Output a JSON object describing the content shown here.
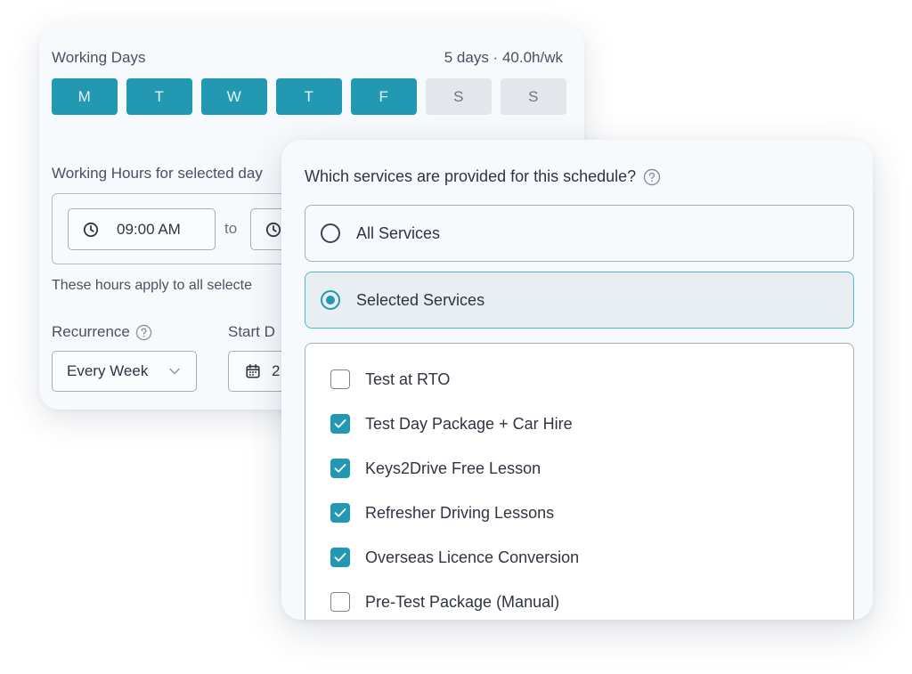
{
  "working_days": {
    "title": "Working Days",
    "summary": "5 days · 40.0h/wk",
    "days": [
      {
        "label": "M",
        "active": true
      },
      {
        "label": "T",
        "active": true
      },
      {
        "label": "W",
        "active": true
      },
      {
        "label": "T",
        "active": true
      },
      {
        "label": "F",
        "active": true
      },
      {
        "label": "S",
        "active": false
      },
      {
        "label": "S",
        "active": false
      }
    ]
  },
  "working_hours": {
    "label": "Working Hours for selected day",
    "start_time": "09:00 AM",
    "to_label": "to",
    "note": "These hours apply to all selecte"
  },
  "recurrence": {
    "label": "Recurrence",
    "value": "Every Week"
  },
  "start_date": {
    "label": "Start D",
    "value": "2"
  },
  "services": {
    "question": "Which services are provided for this schedule?",
    "options": [
      {
        "label": "All Services",
        "selected": false
      },
      {
        "label": "Selected Services",
        "selected": true
      }
    ],
    "items": [
      {
        "label": "Test at RTO",
        "checked": false
      },
      {
        "label": "Test Day Package + Car Hire",
        "checked": true
      },
      {
        "label": "Keys2Drive Free Lesson",
        "checked": true
      },
      {
        "label": "Refresher Driving Lessons",
        "checked": true
      },
      {
        "label": "Overseas Licence Conversion",
        "checked": true
      },
      {
        "label": "Pre-Test Package (Manual)",
        "checked": false
      }
    ]
  },
  "colors": {
    "accent": "#2298b3",
    "inactive_day": "#e3e7eb",
    "card_bg": "#f7fafc",
    "selected_option_bg": "#e8eef1"
  },
  "icons": {
    "clock": "clock-icon",
    "help": "help-circle-icon",
    "chevron": "chevron-down-icon",
    "calendar": "calendar-icon",
    "check": "check-icon"
  }
}
